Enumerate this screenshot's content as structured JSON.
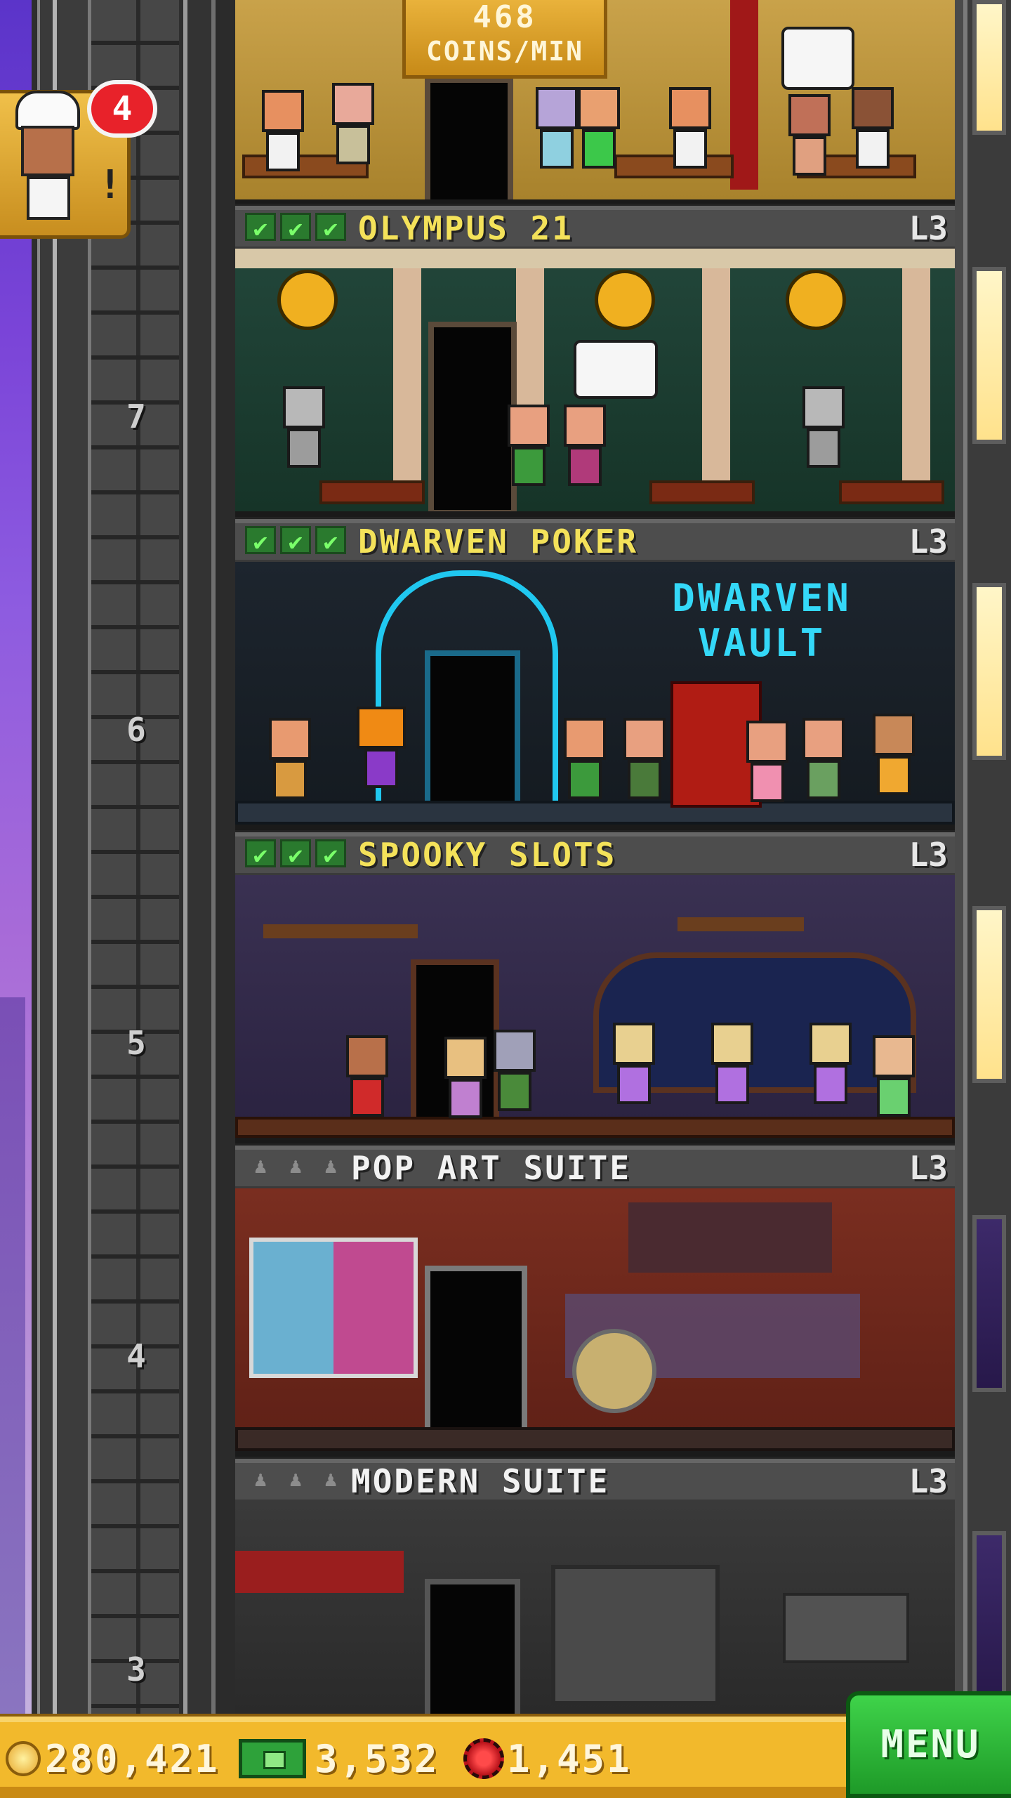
{
  "hud": {
    "coins_per_min_value": "468",
    "coins_per_min_unit": "COINS/MIN",
    "notification_count": "4",
    "chef_alert": "!"
  },
  "floors": [
    {
      "number": "7",
      "name": "OLYMPUS 21",
      "level": "L3",
      "stocked": 3,
      "theme_color": "#1f4a3a"
    },
    {
      "number": "6",
      "name": "DWARVEN POKER",
      "level": "L3",
      "stocked": 3,
      "theme_color": "#1c2430",
      "sign": "DWARVEN VAULT"
    },
    {
      "number": "5",
      "name": "SPOOKY SLOTS",
      "level": "L3",
      "stocked": 3,
      "theme_color": "#3a2e4e"
    },
    {
      "number": "4",
      "name": "POP ART SUITE",
      "level": "L3",
      "stocked": 0,
      "theme_color": "#7a2a1e"
    },
    {
      "number": "3",
      "name": "MODERN SUITE",
      "level": "L3",
      "stocked": 0,
      "theme_color": "#2e2e2e"
    }
  ],
  "resources": {
    "coins": "280,421",
    "bux": "3,532",
    "chips": "1,451"
  },
  "menu": {
    "label": "MENU"
  },
  "icons": {
    "check": "✔",
    "person_slot": "♟"
  }
}
